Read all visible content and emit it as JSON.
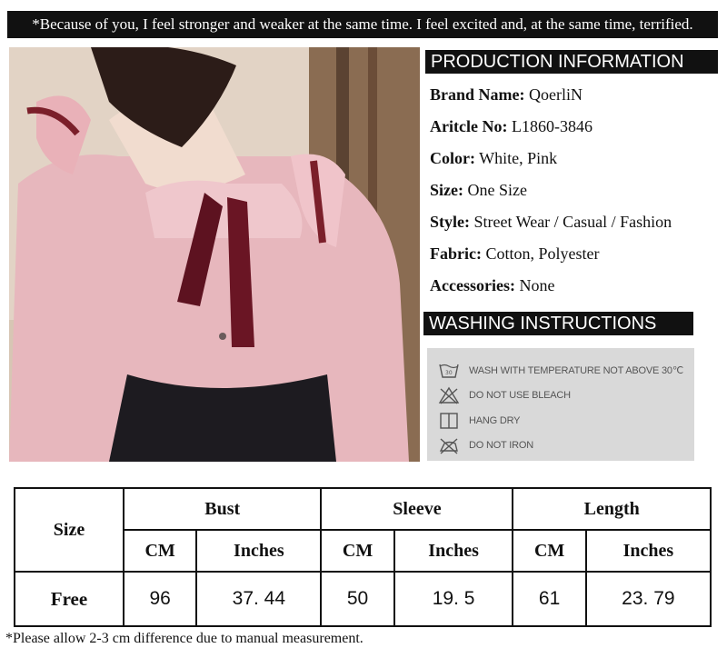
{
  "banner": "*Because of you, I feel stronger and weaker at the same time. I feel excited and, at the same time, terrified.",
  "production_title": "PRODUCTION INFORMATION",
  "info": [
    {
      "label": "Brand Name:",
      "value": " QoerliN"
    },
    {
      "label": "Aritcle No:",
      "value": " L1860-3846"
    },
    {
      "label": "Color:",
      "value": " White, Pink"
    },
    {
      "label": "Size:",
      "value": " One Size"
    },
    {
      "label": "Style:",
      "value": "  Street Wear / Casual / Fashion"
    },
    {
      "label": "Fabric:",
      "value": " Cotton, Polyester"
    },
    {
      "label": "Accessories:",
      "value": " None"
    }
  ],
  "washing_title": "WASHING INSTRUCTIONS",
  "washing": [
    {
      "icon": "wash-30-icon",
      "text": "WASH WITH TEMPERATURE NOT ABOVE 30℃"
    },
    {
      "icon": "no-bleach-icon",
      "text": "DO NOT USE BLEACH"
    },
    {
      "icon": "hang-dry-icon",
      "text": "HANG DRY"
    },
    {
      "icon": "no-iron-icon",
      "text": "DO NOT IRON"
    }
  ],
  "table": {
    "size_header": "Size",
    "groups": [
      "Bust",
      "Sleeve",
      "Length"
    ],
    "units": [
      "CM",
      "Inches",
      "CM",
      "Inches",
      "CM",
      "Inches"
    ],
    "row": {
      "size": "Free",
      "values": [
        "96",
        "37. 44",
        "50",
        "19. 5",
        "61",
        "23. 79"
      ]
    }
  },
  "footnote": "*Please allow 2-3 cm difference due to manual measurement."
}
